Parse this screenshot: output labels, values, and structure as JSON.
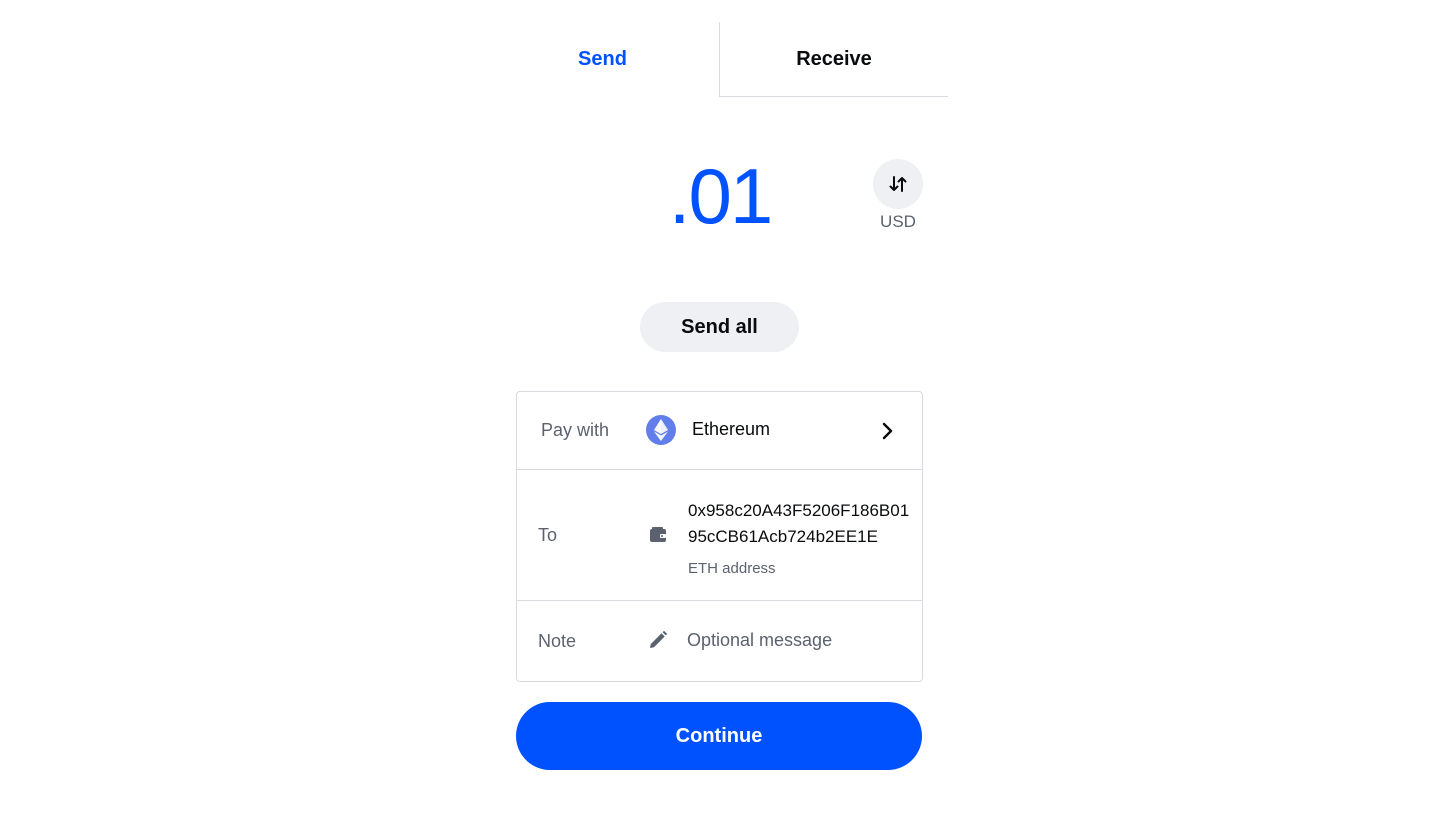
{
  "tabs": [
    {
      "label": "Send",
      "active": true
    },
    {
      "label": "Receive",
      "active": false
    }
  ],
  "amount": {
    "value": ".01",
    "currency": "USD"
  },
  "send_all_label": "Send all",
  "form": {
    "pay_with": {
      "label": "Pay with",
      "asset": "Ethereum",
      "icon": "ethereum-icon"
    },
    "to": {
      "label": "To",
      "address": "0x958c20A43F5206F186B0195cCB61Acb724b2EE1E",
      "address_type": "ETH address",
      "icon": "wallet-icon"
    },
    "note": {
      "label": "Note",
      "placeholder": "Optional message",
      "value": "",
      "icon": "pencil-icon"
    }
  },
  "continue_label": "Continue",
  "colors": {
    "accent": "#0052ff",
    "muted_bg": "#eef0f3",
    "border": "#d8dadf",
    "secondary_text": "#5b616e",
    "eth_brand": "#627eea"
  }
}
